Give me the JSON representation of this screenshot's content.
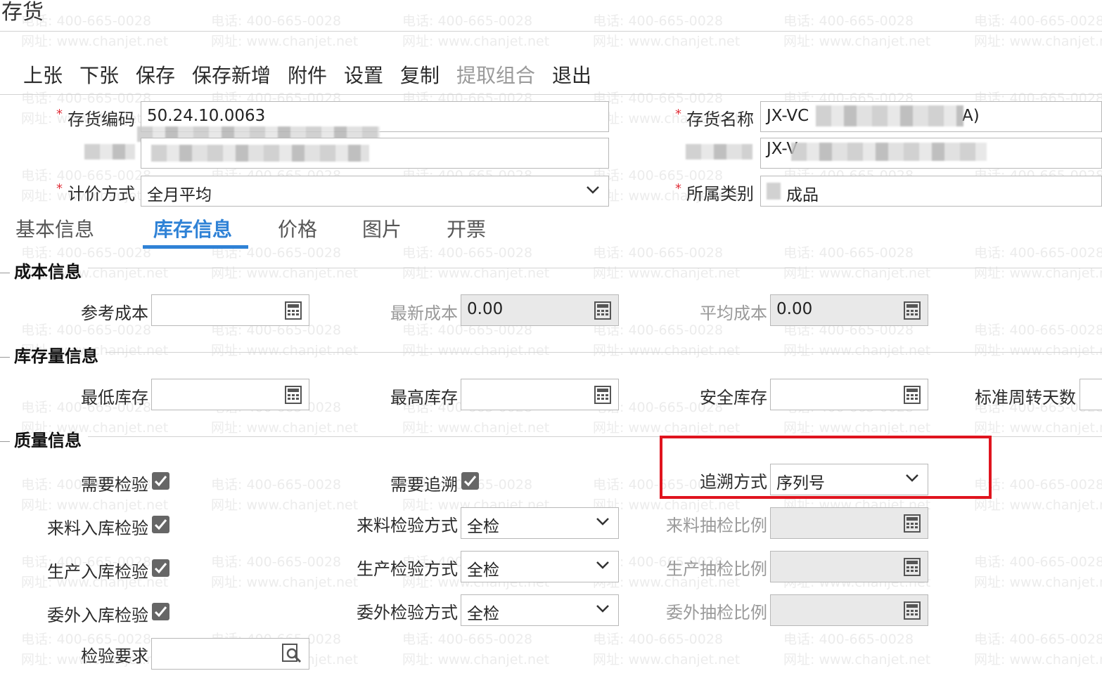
{
  "window": {
    "title": "存货"
  },
  "watermark": {
    "phone": "电话: 400-665-0028",
    "site": "网址: www.chanjet.net"
  },
  "toolbar": {
    "items": [
      {
        "label": "上张",
        "disabled": false
      },
      {
        "label": "下张",
        "disabled": false
      },
      {
        "label": "保存",
        "disabled": false
      },
      {
        "label": "保存新增",
        "disabled": false
      },
      {
        "label": "附件",
        "disabled": false
      },
      {
        "label": "设置",
        "disabled": false
      },
      {
        "label": "复制",
        "disabled": false
      },
      {
        "label": "提取组合",
        "disabled": true
      },
      {
        "label": "退出",
        "disabled": false
      }
    ]
  },
  "header_form": {
    "code_label": "存货编码",
    "code_value": "50.24.10.0063",
    "name_label": "存货名称",
    "name_value_prefix": "JX-VC",
    "name_value_suffix": "A)",
    "spec_value_prefix": "JX-V",
    "pricing_label": "计价方式",
    "pricing_value": "全月平均",
    "category_label": "所属类别",
    "category_value": "成品"
  },
  "tabs": [
    {
      "label": "基本信息",
      "active": false
    },
    {
      "label": "库存信息",
      "active": true
    },
    {
      "label": "价格",
      "active": false
    },
    {
      "label": "图片",
      "active": false
    },
    {
      "label": "开票",
      "active": false
    }
  ],
  "cost_section": {
    "title": "成本信息",
    "ref_cost_label": "参考成本",
    "ref_cost_value": "",
    "latest_cost_label": "最新成本",
    "latest_cost_value": "0.00",
    "avg_cost_label": "平均成本",
    "avg_cost_value": "0.00"
  },
  "stock_section": {
    "title": "库存量信息",
    "min_label": "最低库存",
    "max_label": "最高库存",
    "safety_label": "安全库存",
    "turnover_label": "标准周转天数"
  },
  "quality_section": {
    "title": "质量信息",
    "need_inspect_label": "需要检验",
    "need_inspect_checked": true,
    "need_trace_label": "需要追溯",
    "need_trace_checked": true,
    "trace_method_label": "追溯方式",
    "trace_method_value": "序列号",
    "incoming_label": "来料入库检验",
    "incoming_checked": true,
    "incoming_method_label": "来料检验方式",
    "incoming_method_value": "全检",
    "incoming_ratio_label": "来料抽检比例",
    "production_label": "生产入库检验",
    "production_checked": true,
    "production_method_label": "生产检验方式",
    "production_method_value": "全检",
    "production_ratio_label": "生产抽检比例",
    "outsourcing_label": "委外入库检验",
    "outsourcing_checked": true,
    "outsourcing_method_label": "委外检验方式",
    "outsourcing_method_value": "全检",
    "outsourcing_ratio_label": "委外抽检比例",
    "requirement_label": "检验要求"
  }
}
